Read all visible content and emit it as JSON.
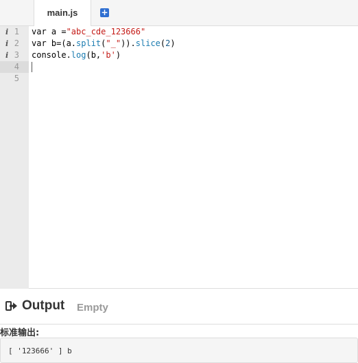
{
  "tabs": [
    {
      "label": "main.js"
    }
  ],
  "add_tab_icon": "plus-square-icon",
  "editor": {
    "gutter": [
      {
        "num": "1",
        "marker": "i"
      },
      {
        "num": "2",
        "marker": "i"
      },
      {
        "num": "3",
        "marker": "i"
      },
      {
        "num": "4",
        "marker": ""
      },
      {
        "num": "5",
        "marker": ""
      }
    ],
    "lines": [
      {
        "parts": [
          {
            "t": "var a =",
            "c": ""
          },
          {
            "t": "\"abc_cde_123666\"",
            "c": "str"
          }
        ]
      },
      {
        "parts": [
          {
            "t": "var b=(a.",
            "c": ""
          },
          {
            "t": "split",
            "c": "fn"
          },
          {
            "t": "(",
            "c": ""
          },
          {
            "t": "\"_\"",
            "c": "str"
          },
          {
            "t": ")).",
            "c": ""
          },
          {
            "t": "slice",
            "c": "fn"
          },
          {
            "t": "(",
            "c": ""
          },
          {
            "t": "2",
            "c": "num"
          },
          {
            "t": ")",
            "c": ""
          }
        ]
      },
      {
        "parts": [
          {
            "t": "console.",
            "c": ""
          },
          {
            "t": "log",
            "c": "fn"
          },
          {
            "t": "(b,",
            "c": ""
          },
          {
            "t": "'b'",
            "c": "str"
          },
          {
            "t": ")",
            "c": ""
          }
        ]
      },
      {
        "parts": []
      },
      {
        "parts": []
      }
    ],
    "active_line": 4
  },
  "output": {
    "icon": "sign-out-icon",
    "title": "Output",
    "status": "Empty",
    "stdout_label": "标准输出:",
    "stdout": "[ '123666' ] b"
  },
  "colors": {
    "string": "#c41a16",
    "function": "#1a7bb0",
    "number": "#1a5c8a"
  }
}
